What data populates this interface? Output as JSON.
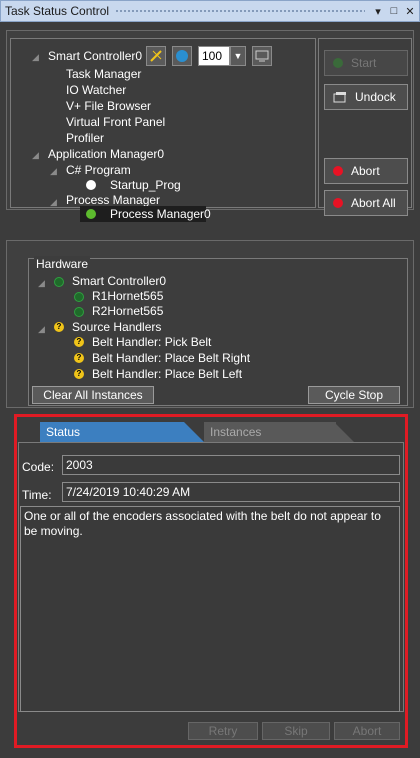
{
  "window": {
    "title": "Task Status Control"
  },
  "controller": {
    "name": "Smart Controller0",
    "speed_value": "100",
    "items": [
      "Task Manager",
      "IO Watcher",
      "V+ File Browser",
      "Virtual Front Panel",
      "Profiler"
    ]
  },
  "app_manager": {
    "name": "Application Manager0",
    "csharp": "C# Program",
    "startup": "Startup_Prog",
    "process_manager": "Process Manager",
    "process_manager_item": "Process Manager0"
  },
  "side_buttons": {
    "start": "Start",
    "undock": "Undock",
    "abort": "Abort",
    "abort_all": "Abort All"
  },
  "hardware": {
    "label": "Hardware",
    "controller": "Smart Controller0",
    "robots": [
      "R1Hornet565",
      "R2Hornet565"
    ],
    "source_handlers": "Source Handlers",
    "belt_handlers": [
      "Belt Handler: Pick Belt",
      "Belt Handler: Place Belt Right",
      "Belt Handler: Place Belt Left"
    ],
    "clear_all": "Clear All Instances",
    "cycle_stop": "Cycle Stop"
  },
  "tabs": {
    "status": "Status",
    "instances": "Instances"
  },
  "status": {
    "code_label": "Code:",
    "code_value": "2003",
    "time_label": "Time:",
    "time_value": "7/24/2019 10:40:29 AM",
    "message": "One or all of the encoders associated with the belt do not appear to be moving."
  },
  "bottom_buttons": {
    "retry": "Retry",
    "skip": "Skip",
    "abort": "Abort"
  },
  "colors": {
    "accent_blue": "#3c7fc0",
    "highlight_red": "#e01b24",
    "status_green": "#5dbb2e",
    "warning_yellow": "#f0c419"
  }
}
